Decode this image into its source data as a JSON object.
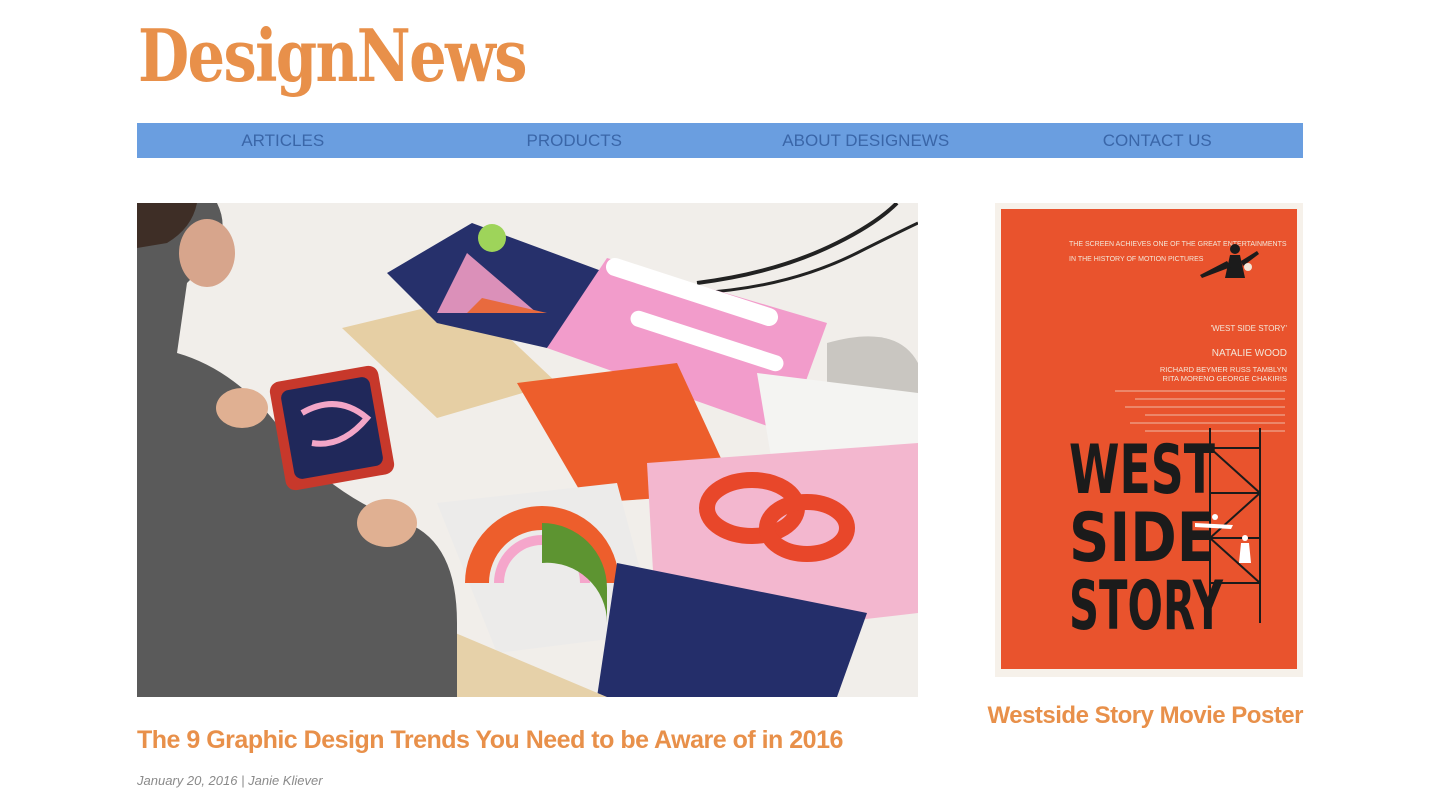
{
  "site": {
    "logo": "DesignNews"
  },
  "nav": {
    "items": [
      {
        "label": "ARTICLES"
      },
      {
        "label": "PRODUCTS"
      },
      {
        "label": "ABOUT DESIGNEWS"
      },
      {
        "label": "CONTACT US"
      }
    ]
  },
  "featured": {
    "title": "The 9 Graphic Design Trends You Need to be Aware of in 2016",
    "date": "January 20, 2016",
    "separator": "|",
    "author": "Janie Kliever"
  },
  "sidebar": {
    "title": "Westside Story Movie Poster",
    "poster": {
      "tagline1": "THE SCREEN ACHIEVES ONE OF THE GREAT ENTERTAINMENTS",
      "tagline2": "IN THE HISTORY OF MOTION PICTURES",
      "film_title": "'WEST SIDE STORY'",
      "star": "NATALIE WOOD",
      "cast1": "RICHARD BEYMER  RUSS TAMBLYN",
      "cast2": "RITA MORENO  GEORGE CHAKIRIS",
      "word1": "WEST",
      "word2": "SIDE",
      "word3": "STORY"
    }
  },
  "colors": {
    "accent": "#e8904a",
    "nav_bg": "#6a9ee0",
    "nav_text": "#3a66a8",
    "poster_red": "#e9532d"
  }
}
